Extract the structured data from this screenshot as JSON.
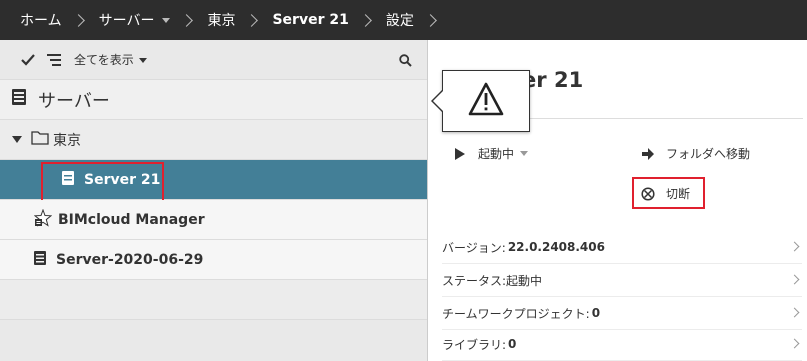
{
  "breadcrumb": {
    "home": "ホーム",
    "servers": "サーバー",
    "location": "東京",
    "server": "Server 21",
    "settings": "設定"
  },
  "toolbar": {
    "show_all_label": "全てを表示"
  },
  "panel": {
    "title": "サーバー"
  },
  "tree": {
    "folder_label": "東京",
    "selected_server": "Server 21",
    "items": [
      {
        "label": "BIMcloud Manager",
        "icon": "manager-star-icon"
      },
      {
        "label": "Server-2020-06-29",
        "icon": "server-icon"
      }
    ]
  },
  "detail": {
    "title": "Server 21",
    "title_visible_part": "rver 21",
    "status_action": "起動中",
    "move_action": "フォルダへ移動",
    "disconnect_action": "切断",
    "info": [
      {
        "label": "バージョン: ",
        "value": "22.0.2408.406"
      },
      {
        "label": "ステータス: ",
        "value": "起動中",
        "plain": true
      },
      {
        "label": "チームワークプロジェクト: ",
        "value": "0"
      },
      {
        "label": "ライブラリ: ",
        "value": "0"
      }
    ]
  },
  "colors": {
    "topbar_bg": "#2d2d2d",
    "selected_row_bg": "#437f97",
    "highlight_border": "#e0202e"
  }
}
